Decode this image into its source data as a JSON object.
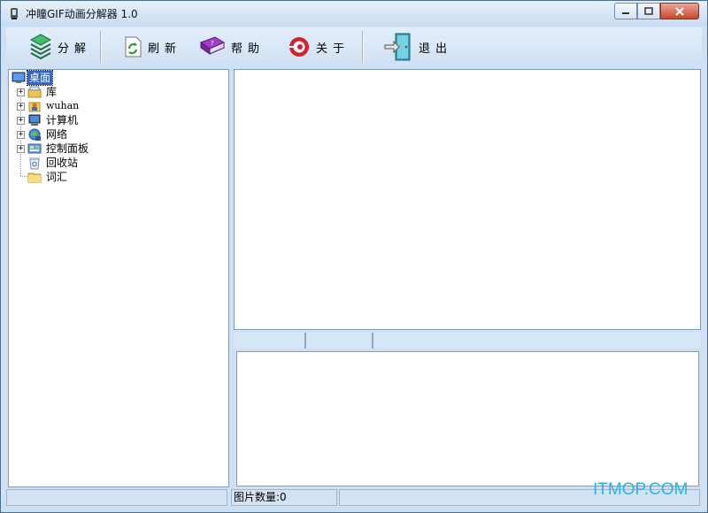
{
  "window": {
    "title": "冲瞳GIF动画分解器 1.0"
  },
  "toolbar": {
    "buttons": [
      {
        "label": "分解",
        "icon": "layers-icon"
      },
      {
        "label": "刷新",
        "icon": "refresh-icon"
      },
      {
        "label": "帮助",
        "icon": "help-book-icon"
      },
      {
        "label": "关于",
        "icon": "about-icon"
      },
      {
        "label": "退出",
        "icon": "exit-door-icon"
      }
    ]
  },
  "tree": {
    "root": {
      "label": "桌面",
      "icon": "desktop-icon"
    },
    "items": [
      {
        "label": "库",
        "icon": "library-icon",
        "expandable": true
      },
      {
        "label": "wuhan",
        "icon": "user-folder-icon",
        "expandable": true
      },
      {
        "label": "计算机",
        "icon": "computer-icon",
        "expandable": true
      },
      {
        "label": "网络",
        "icon": "network-icon",
        "expandable": true
      },
      {
        "label": "控制面板",
        "icon": "control-panel-icon",
        "expandable": true
      },
      {
        "label": "回收站",
        "icon": "recycle-bin-icon",
        "expandable": false
      },
      {
        "label": "词汇",
        "icon": "folder-icon",
        "expandable": false
      }
    ]
  },
  "status": {
    "image_count": "图片数量:0"
  },
  "watermark": "ITMOP.COM",
  "colors": {
    "chrome": "#cfe0f3",
    "selection": "#3166c3",
    "watermark": "#27b4e6"
  }
}
